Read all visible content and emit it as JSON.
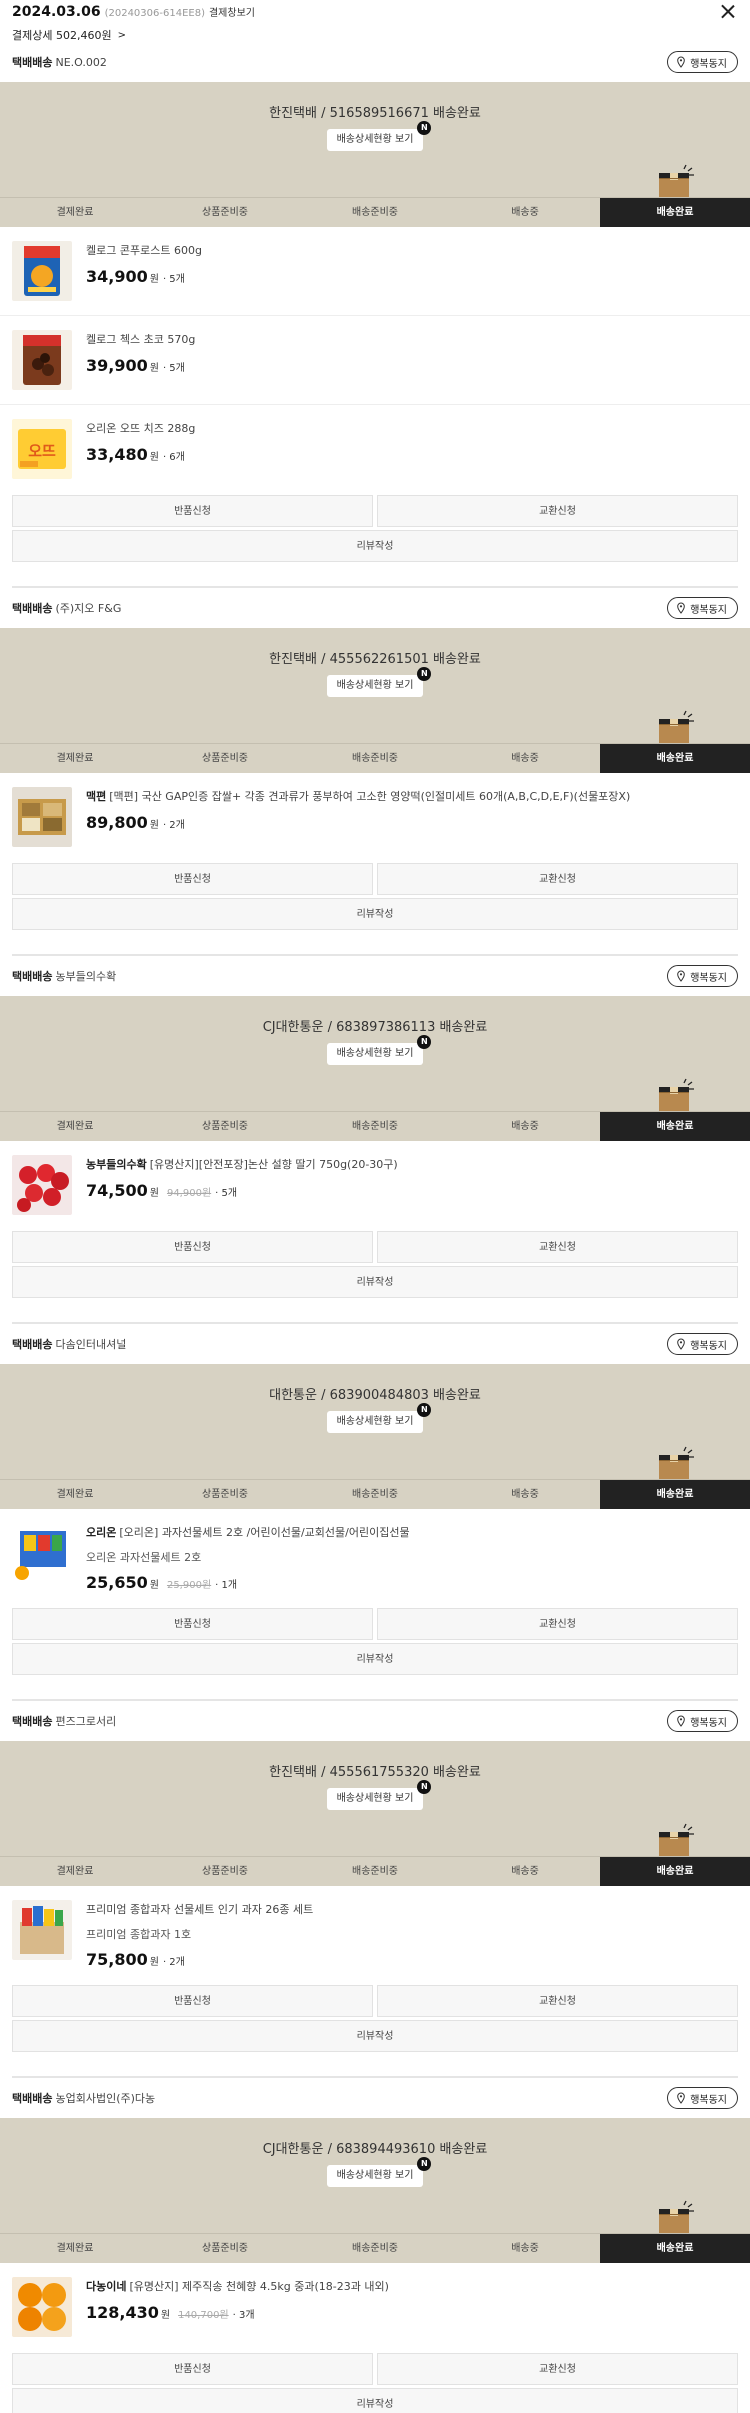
{
  "order": {
    "date": "2024.03.06",
    "order_id": "(20240306-614EE8)",
    "detail_link": "결제창보기",
    "payment": "결제상세 502,460원"
  },
  "steps": [
    "결제완료",
    "상품준비중",
    "배송준비중",
    "배송중",
    "배송완료"
  ],
  "labels": {
    "delivery_prefix": "택배배송",
    "notify_button": "행복동지",
    "track_button": "배송상세현황 보기",
    "new_badge": "N",
    "return_button": "반품신청",
    "exchange_button": "교환신청",
    "review_button": "리뷰작성",
    "currency": "원"
  },
  "shipments": [
    {
      "seller": "NE.O.002",
      "tracking": "한진택배 / 516589516671 배송완료",
      "items": [
        {
          "brand": "",
          "name": "켈로그 콘푸로스트 600g",
          "sub": "",
          "price": "34,900",
          "orig": "",
          "qty": "· 5개",
          "thumb": "cereal"
        },
        {
          "brand": "",
          "name": "켈로그 첵스 초코 570g",
          "sub": "",
          "price": "39,900",
          "orig": "",
          "qty": "· 5개",
          "thumb": "choco"
        },
        {
          "brand": "",
          "name": "오리온 오뜨 치즈 288g",
          "sub": "",
          "price": "33,480",
          "orig": "",
          "qty": "· 6개",
          "thumb": "cheese"
        }
      ]
    },
    {
      "seller": "(주)지오 F&G",
      "tracking": "한진택배 / 455562261501 배송완료",
      "items": [
        {
          "brand": "맥편",
          "name": "[맥편] 국산 GAP인증 잡쌀+ 각종 견과류가 풍부하여 고소한 영양떡(인절미세트 60개(A,B,C,D,E,F)(선물포장X)",
          "sub": "",
          "price": "89,800",
          "orig": "",
          "qty": "· 2개",
          "thumb": "ricecake"
        }
      ]
    },
    {
      "seller": "농부들의수확",
      "tracking": "CJ대한통운 / 683897386113 배송완료",
      "items": [
        {
          "brand": "농부들의수확",
          "name": "[유명산지][안전포장]논산 설향 딸기 750g(20-30구)",
          "sub": "",
          "price": "74,500",
          "orig": "94,900원",
          "qty": "· 5개",
          "thumb": "strawberry"
        }
      ]
    },
    {
      "seller": "다솜인터내셔널",
      "tracking": "대한통운 / 683900484803 배송완료",
      "items": [
        {
          "brand": "오리온",
          "name": "[오리온] 과자선물세트 2호 /어린이선물/교회선물/어린이집선물",
          "sub": "오리온 과자선물세트 2호",
          "price": "25,650",
          "orig": "25,900원",
          "qty": "· 1개",
          "thumb": "snackbox"
        }
      ]
    },
    {
      "seller": "편즈그로서리",
      "tracking": "한진택배 / 455561755320 배송완료",
      "items": [
        {
          "brand": "",
          "name": "프리미엄 종합과자 선물세트 인기 과자 26종 세트",
          "sub": "프리미엄 종합과자 1호",
          "price": "75,800",
          "orig": "",
          "qty": "· 2개",
          "thumb": "snackgift"
        }
      ]
    },
    {
      "seller": "농업회사법인(주)다농",
      "tracking": "CJ대한통운 / 683894493610 배송완료",
      "items": [
        {
          "brand": "다농이네",
          "name": "[유명산지] 제주직송 천혜향 4.5kg 중과(18-23과 내외)",
          "sub": "",
          "price": "128,430",
          "orig": "140,700원",
          "qty": "· 3개",
          "thumb": "orange"
        }
      ]
    }
  ]
}
